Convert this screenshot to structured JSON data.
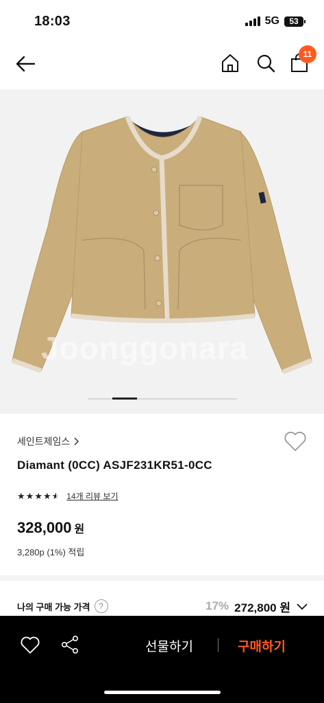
{
  "status": {
    "time": "18:03",
    "network": "5G",
    "battery": "53"
  },
  "header": {
    "cart_count": "11"
  },
  "image": {
    "watermark": "Joonggonara",
    "slide_index": 2,
    "slide_count": 6
  },
  "product": {
    "brand": "세인트제임스",
    "name": "Diamant (0CC) ASJF231KR51-0CC",
    "rating": 4.5,
    "review_link": "14개 리뷰 보기",
    "price": "328,000",
    "price_unit": "원",
    "points": "3,280p (1%) 적립"
  },
  "my_price": {
    "label": "나의 구매 가능 가격",
    "help": "?",
    "discount": "17%",
    "price": "272,800",
    "unit": "원"
  },
  "bottom_bar": {
    "gift_label": "선물하기",
    "buy_label": "구매하기"
  },
  "colors": {
    "accent": "#ff5a1f",
    "jacket": "#c9ae7c",
    "trim": "#e7dccb",
    "lining": "#1f2740"
  }
}
